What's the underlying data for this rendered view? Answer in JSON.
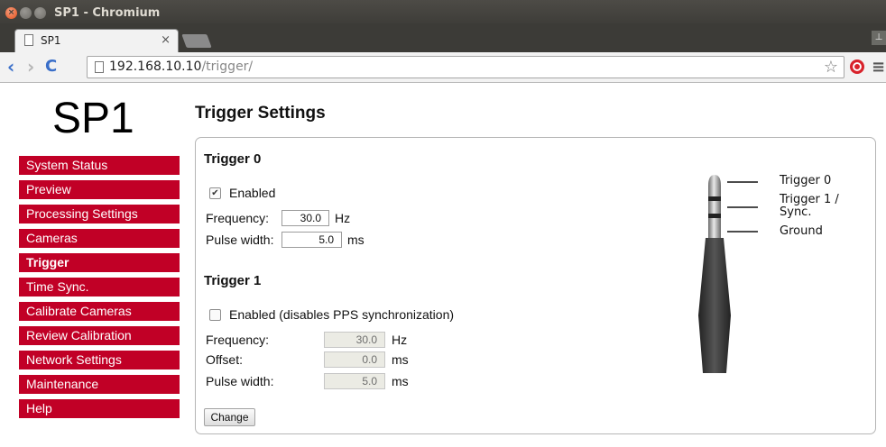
{
  "window": {
    "title": "SP1 - Chromium",
    "close_glyph": "×",
    "profile_glyph": "⊥"
  },
  "tab": {
    "label": "SP1",
    "close_glyph": "×"
  },
  "address": {
    "host": "192.168.10.10",
    "path": "/trigger/",
    "back_glyph": "‹",
    "forward_glyph": "›",
    "reload_glyph": "C",
    "star_glyph": "☆",
    "menu_glyph": "≡"
  },
  "sidebar": {
    "logo": "SP1",
    "items": [
      {
        "label": "System Status",
        "active": false
      },
      {
        "label": "Preview",
        "active": false
      },
      {
        "label": "Processing Settings",
        "active": false
      },
      {
        "label": "Cameras",
        "active": false
      },
      {
        "label": "Trigger",
        "active": true
      },
      {
        "label": "Time Sync.",
        "active": false
      },
      {
        "label": "Calibrate Cameras",
        "active": false
      },
      {
        "label": "Review Calibration",
        "active": false
      },
      {
        "label": "Network Settings",
        "active": false
      },
      {
        "label": "Maintenance",
        "active": false
      },
      {
        "label": "Help",
        "active": false
      }
    ],
    "accent_color": "#c10026"
  },
  "main": {
    "title": "Trigger Settings",
    "trigger0": {
      "title": "Trigger 0",
      "enabled_label": "Enabled",
      "enabled_checked": true,
      "check_glyph": "✔",
      "frequency_label": "Frequency:",
      "frequency_value": "30.0",
      "frequency_unit": "Hz",
      "pulse_label": "Pulse width:",
      "pulse_value": "5.0",
      "pulse_unit": "ms"
    },
    "trigger1": {
      "title": "Trigger 1",
      "enabled_label": "Enabled (disables PPS synchronization)",
      "enabled_checked": false,
      "frequency_label": "Frequency:",
      "frequency_value": "30.0",
      "frequency_unit": "Hz",
      "offset_label": "Offset:",
      "offset_value": "0.0",
      "offset_unit": "ms",
      "pulse_label": "Pulse width:",
      "pulse_value": "5.0",
      "pulse_unit": "ms"
    },
    "change_button": "Change",
    "jack_labels": {
      "tip": "Trigger 0",
      "ring_line1": "Trigger 1 /",
      "ring_line2": "Sync.",
      "sleeve": "Ground"
    }
  }
}
